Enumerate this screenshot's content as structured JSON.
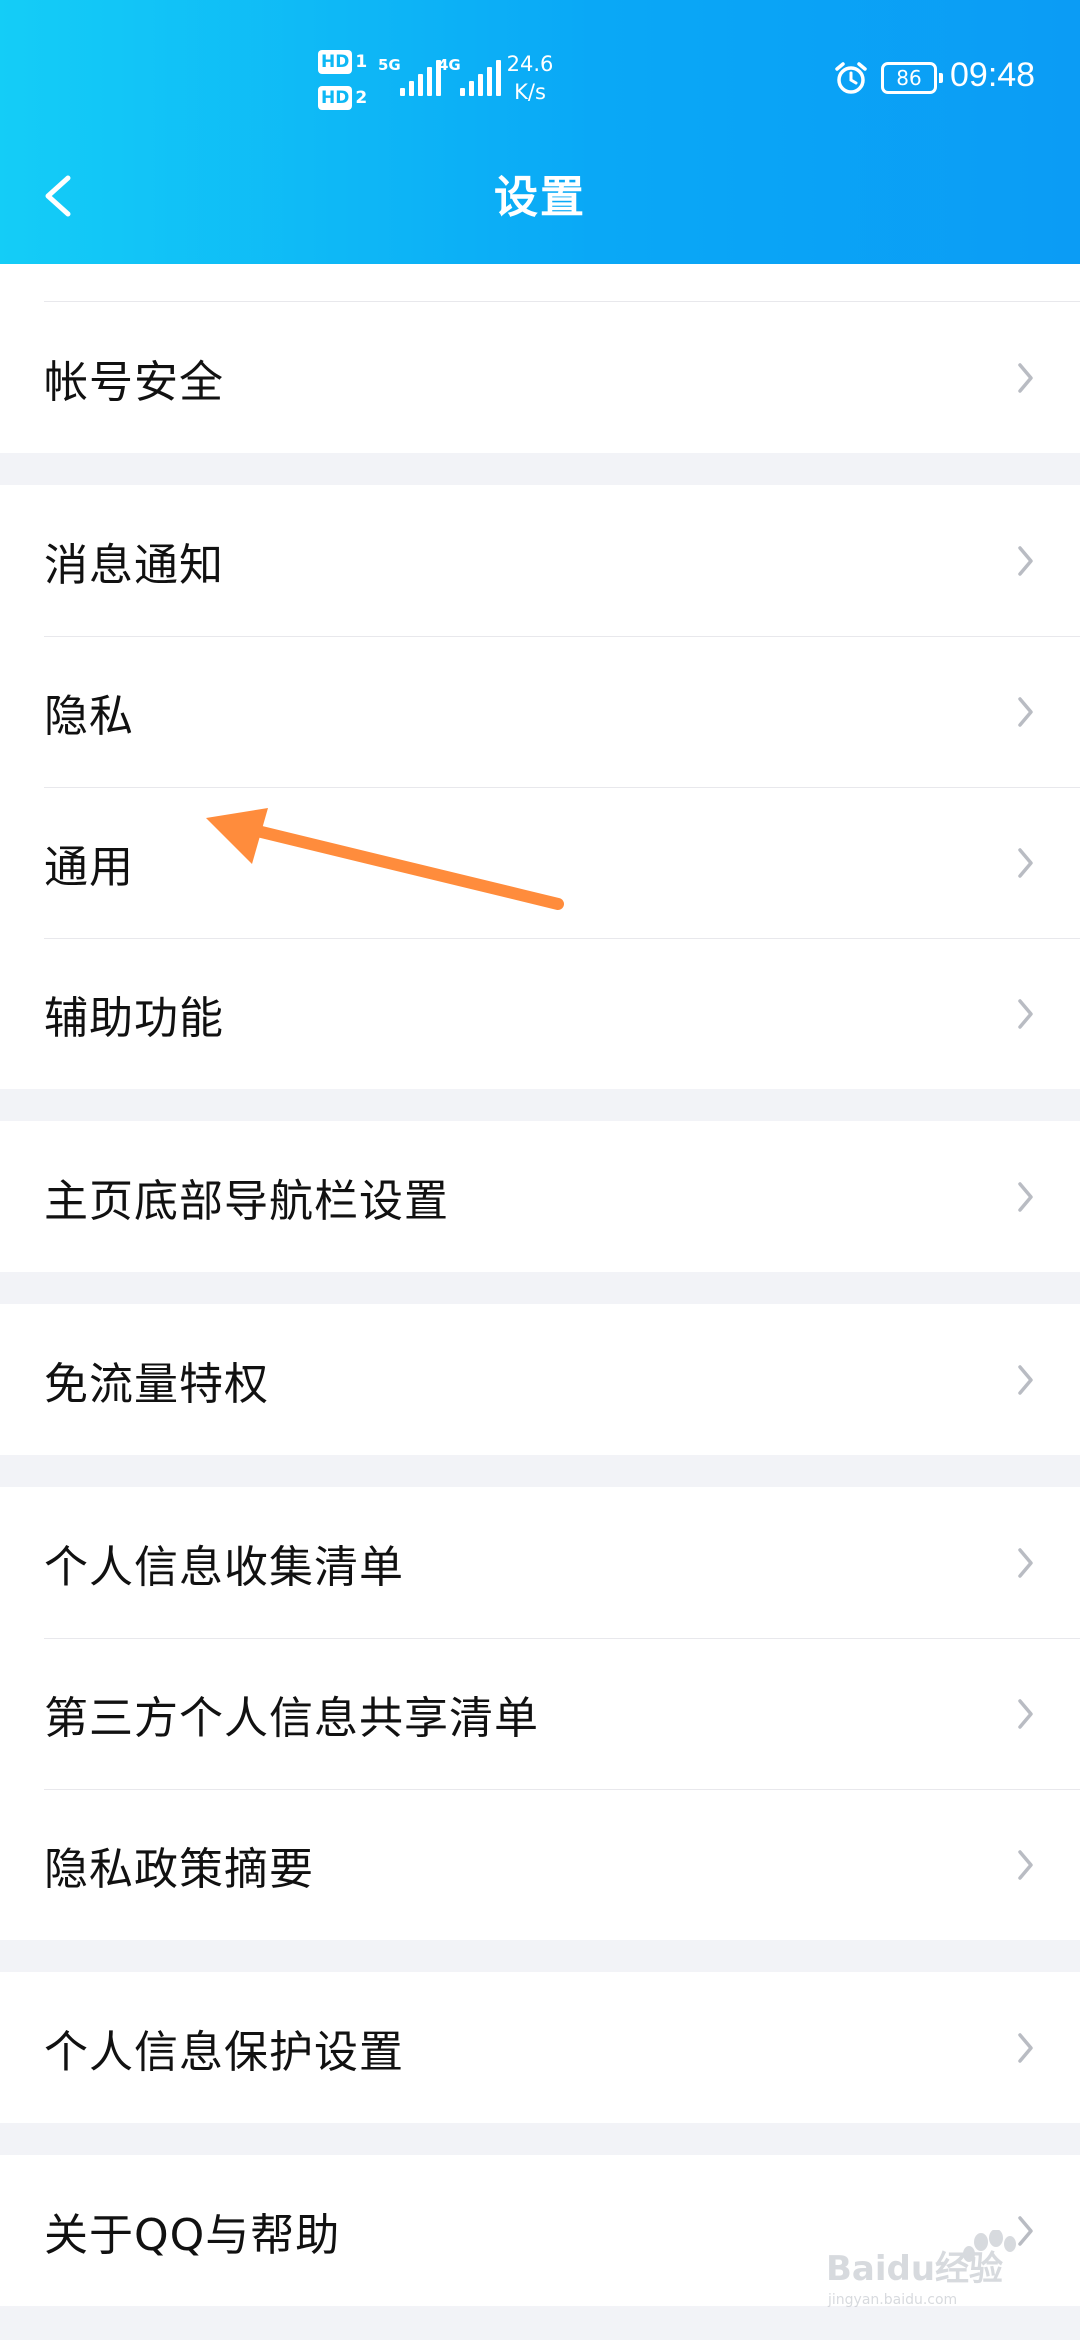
{
  "status_bar": {
    "hd1": "HD",
    "hd1_num": "1",
    "hd2": "HD",
    "hd2_num": "2",
    "signal1": "5G",
    "signal2": "4G",
    "net_speed_value": "24.6",
    "net_speed_unit": "K/s",
    "battery": "86",
    "time": "09:48"
  },
  "header": {
    "title": "设置"
  },
  "groups": [
    {
      "items": [
        "帐号安全"
      ]
    },
    {
      "items": [
        "消息通知",
        "隐私",
        "通用",
        "辅助功能"
      ]
    },
    {
      "items": [
        "主页底部导航栏设置"
      ]
    },
    {
      "items": [
        "免流量特权"
      ]
    },
    {
      "items": [
        "个人信息收集清单",
        "第三方个人信息共享清单",
        "隐私政策摘要"
      ]
    },
    {
      "items": [
        "个人信息保护设置"
      ]
    },
    {
      "items": [
        "关于QQ与帮助"
      ]
    }
  ],
  "annotation": {
    "color": "#ff8c3c"
  },
  "watermark": {
    "text": "Baidu经验",
    "sub": "jingyan.baidu.com"
  },
  "colors": {
    "header_start": "#14cdf7",
    "header_end": "#0b9cf5",
    "background": "#f2f3f7"
  }
}
